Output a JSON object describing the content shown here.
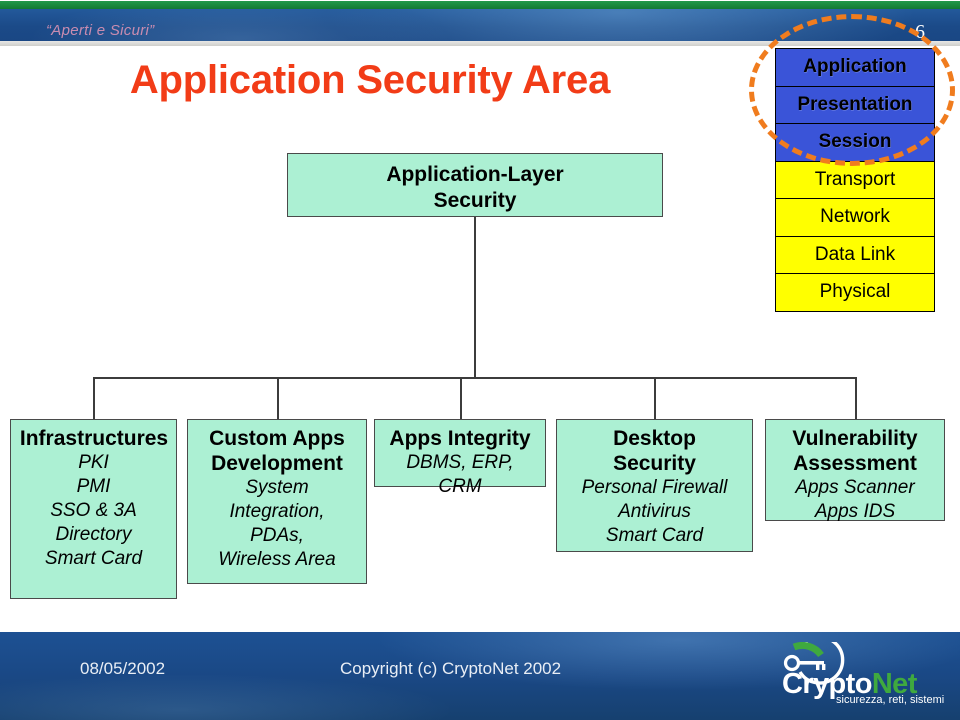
{
  "header": {
    "banner_title": "“Aperti e Sicuri”",
    "slide_number": "6",
    "accent_green": "#1a8a3c",
    "band_blue": "#1c4f8f",
    "title_color": "#c98cb0"
  },
  "slide": {
    "title": "Application Security Area",
    "title_color": "#f23c17"
  },
  "osi": {
    "highlight_color": "#f07c1e",
    "upper_color": "#3a54d8",
    "lower_color": "#ffff00",
    "layers": [
      {
        "label": "Application",
        "group": "upper"
      },
      {
        "label": "Presentation",
        "group": "upper"
      },
      {
        "label": "Session",
        "group": "upper"
      },
      {
        "label": "Transport",
        "group": "lower"
      },
      {
        "label": "Network",
        "group": "lower"
      },
      {
        "label": "Data Link",
        "group": "lower"
      },
      {
        "label": "Physical",
        "group": "lower"
      }
    ]
  },
  "diagram": {
    "box_fill": "#acf0d3",
    "root": {
      "heading_line1": "Application-Layer",
      "heading_line2": "Security"
    },
    "children": [
      {
        "heading": "Infrastructures",
        "details": [
          "PKI",
          "PMI",
          "SSO & 3A",
          "Directory",
          "Smart Card"
        ]
      },
      {
        "heading_line1": "Custom Apps",
        "heading_line2": "Development",
        "details": [
          "System",
          "Integration,",
          "PDAs,",
          "Wireless Area"
        ]
      },
      {
        "heading": "Apps Integrity",
        "details": [
          "DBMS, ERP,",
          "CRM"
        ]
      },
      {
        "heading_line1": "Desktop",
        "heading_line2": "Security",
        "details": [
          "Personal Firewall",
          "Antivirus",
          "Smart Card"
        ]
      },
      {
        "heading_line1": "Vulnerability",
        "heading_line2": "Assessment",
        "details": [
          "Apps Scanner",
          "Apps IDS"
        ]
      }
    ]
  },
  "footer": {
    "date": "08/05/2002",
    "copyright": "Copyright (c) CryptoNet 2002",
    "logo": {
      "word_primary": "Crypto",
      "word_accent": "Net",
      "tagline": "sicurezza, reti, sistemi",
      "accent_color": "#3fa93f"
    }
  }
}
